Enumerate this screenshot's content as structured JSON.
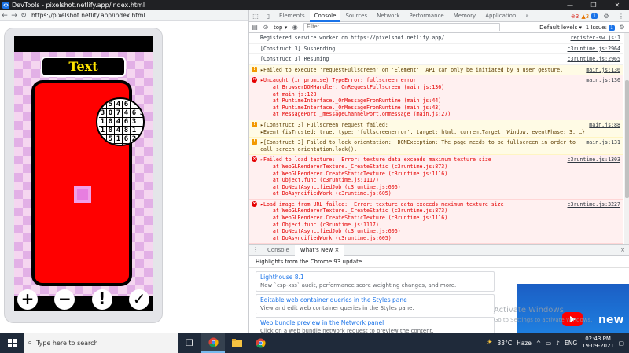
{
  "window": {
    "title": "DevTools - pixelshot.netlify.app/index.html",
    "controls": [
      "—",
      "❐",
      "✕"
    ]
  },
  "browser": {
    "url": "https://pixelshot.netlify.app/index.html"
  },
  "game": {
    "title": "Text",
    "grid": [
      [
        "3",
        "5",
        "4",
        "6",
        "",
        ""
      ],
      [
        "3",
        "0",
        "7",
        "4",
        "6",
        "3"
      ],
      [
        "1",
        "0",
        "4",
        "6",
        "3",
        ""
      ],
      [
        "1",
        "0",
        "4",
        "8",
        "1",
        ""
      ],
      [
        "",
        "5",
        "1",
        "6",
        "2",
        ""
      ],
      [
        "",
        "",
        "",
        "",
        "",
        ""
      ]
    ],
    "buttons": [
      {
        "name": "plus",
        "label": "+"
      },
      {
        "name": "minus",
        "label": "−"
      },
      {
        "name": "hint",
        "label": "!"
      },
      {
        "name": "check",
        "label": "✓"
      }
    ]
  },
  "devtools": {
    "tabs": [
      "Elements",
      "Console",
      "Sources",
      "Network",
      "Performance",
      "Memory",
      "Application"
    ],
    "active_tab": "Console",
    "more_tabs": "»",
    "errors_count": "3",
    "warnings_count": "3",
    "info_count": "1",
    "context": "top",
    "filter_placeholder": "Filter",
    "levels": "Default levels ▾",
    "issues": "1 Issue:",
    "issues_count": "1",
    "messages": [
      {
        "type": "log",
        "text": "Registered service worker on https://pixelshot.netlify.app/",
        "src": "register-sw.js:1"
      },
      {
        "type": "log",
        "text": "[Construct 3] Suspending",
        "src": "c3runtime.js:2964"
      },
      {
        "type": "log",
        "text": "[Construct 3] Resuming",
        "src": "c3runtime.js:2965"
      },
      {
        "type": "warn",
        "text": "▸Failed to execute 'requestFullscreen' on 'Element': API can only be initiated by a user gesture.",
        "src": "main.js:136"
      },
      {
        "type": "error",
        "text": "▸Uncaught (in promise) TypeError: fullscreen error\n    at BrowserDOMHandler._OnRequestFullscreen (main.js:136)\n    at main.js:128\n    at RuntimeInterface._OnMessageFromRuntime (main.js:44)\n    at RuntimeInterface._OnMessageFromRuntime (main.js:43)\n    at MessagePort._messageChannelPort.onmessage (main.js:27)",
        "src": "main.js:136"
      },
      {
        "type": "warn",
        "text": "▸[Construct 3] Fullscreen request failed:\n▸Event {isTrusted: true, type: 'fullscreenerror', target: html, currentTarget: Window, eventPhase: 3, …}",
        "src": "main.js:88"
      },
      {
        "type": "warn",
        "text": "▸[Construct 3] Failed to lock orientation:  DOMException: The page needs to be fullscreen in order to\ncall screen.orientation.lock().",
        "src": "main.js:131"
      },
      {
        "type": "error",
        "text": "▸Failed to load texture:  Error: texture data exceeds maximum texture size\n    at WebGLRendererTexture._CreateStatic (c3runtime.js:873)\n    at WebGLRenderer.CreateStaticTexture (c3runtime.js:1116)\n    at Object.func (c3runtime.js:1117)\n    at DoNextAsyncifiedJob (c3runtime.js:606)\n    at DoAsyncifiedWork (c3runtime.js:605)",
        "src": "c3runtime.js:1303"
      },
      {
        "type": "error",
        "text": "▸Load image from URL failed:  Error: texture data exceeds maximum texture size\n    at WebGLRendererTexture._CreateStatic (c3runtime.js:873)\n    at WebGLRenderer.CreateStaticTexture (c3runtime.js:1116)\n    at Object.func (c3runtime.js:1117)\n    at DoNextAsyncifiedJob (c3runtime.js:606)\n    at DoAsyncifiedWork (c3runtime.js:605)",
        "src": "c3runtime.js:3227"
      }
    ],
    "prompt": "›"
  },
  "drawer": {
    "tabs": [
      "Console",
      "What's New"
    ],
    "active_tab": "What's New",
    "close": "×",
    "header": "Highlights from the Chrome 93 update",
    "cards": [
      {
        "title": "Lighthouse 8.1",
        "desc": "New `csp-xss` audit, performance score weighting changes, and more."
      },
      {
        "title": "Editable web container queries in the Styles pane",
        "desc": "View and edit web container queries in the Styles pane."
      },
      {
        "title": "Web bundle preview in the Network panel",
        "desc": "Click on a web bundle network request to preview the content."
      }
    ],
    "video_text": "new",
    "watermark_title": "Activate Windows",
    "watermark_sub": "Go to Settings to activate Windows."
  },
  "taskbar": {
    "search_placeholder": "Type here to search",
    "temperature": "33°C",
    "weather": "Haze",
    "language": "ENG",
    "time": "02:43 PM",
    "date": "19-09-2021"
  },
  "colors": {
    "accent": "#1a73e8",
    "error": "#e50000",
    "warning": "#f29900",
    "game_red": "#ff0000",
    "game_title": "#ffe400"
  }
}
